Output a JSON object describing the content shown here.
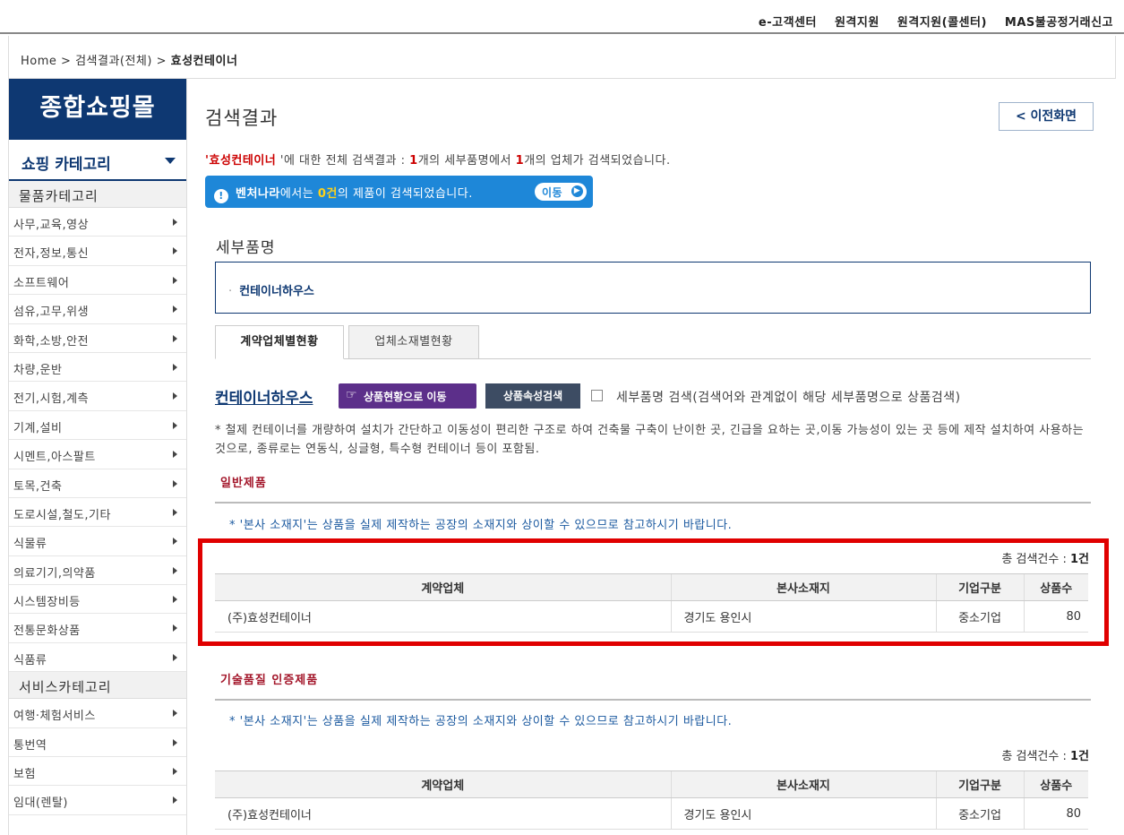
{
  "util_links": [
    "e-고객센터",
    "원격지원",
    "원격지원(콜센터)",
    "MAS불공정거래신고"
  ],
  "breadcrumb": {
    "home": "Home",
    "sep1": " > ",
    "mid": "검색결과(전체)",
    "sep2": " > ",
    "current": "효성컨테이너"
  },
  "sidebar": {
    "brand": "종합쇼핑몰",
    "category_head": "쇼핑 카테고리",
    "goods_group": "물품카테고리",
    "goods_items": [
      "사무,교육,영상",
      "전자,정보,통신",
      "소프트웨어",
      "섬유,고무,위생",
      "화학,소방,안전",
      "차량,운반",
      "전기,시험,계측",
      "기계,설비",
      "시멘트,아스팔트",
      "토목,건축",
      "도로시설,철도,기타",
      "식물류",
      "의료기기,의약품",
      "시스템장비등",
      "전통문화상품",
      "식품류"
    ],
    "service_group": "서비스카테고리",
    "service_items": [
      "여행·체험서비스",
      "통번역",
      "보험",
      "임대(렌탈)"
    ]
  },
  "main": {
    "title": "검색결과",
    "back_button": "< 이전화면",
    "summary": {
      "q1": "'",
      "keyword": "효성컨테이너",
      "q2": " '에 대한 전체 검색결과 : ",
      "n1": "1",
      "t1": "개의 세부품명에서 ",
      "n2": "1",
      "t2": "개의 업체가 검색되었습니다."
    },
    "venture": {
      "icon": "!",
      "name": "벤처나라",
      "t1": "에서는 ",
      "count": "0건",
      "t2": "의 제품이 검색되었습니다.",
      "move": "이동"
    },
    "detail_title": "세부품명",
    "detail_item": "컨테이너하우스",
    "tabs": [
      "계약업체별현황",
      "업체소재별현황"
    ],
    "product_name": "컨테이너하우스",
    "btn_status": "상품현황으로 이동",
    "btn_attr": "상품속성검색",
    "checkbox_label": "세부품명 검색(검색어와 관계없이 해당 세부품명으로 상품검색)",
    "description": "* 철제 컨테이너를 개량하여 설치가 간단하고 이동성이 편리한 구조로 하여 건축물 구축이 난이한 곳, 긴급을 요하는 곳,이동 가능성이 있는 곳 등에 제작 설치하여 사용하는 것으로, 종류로는 연동식, 싱글형, 특수형 컨테이너 등이 포함됨.",
    "sections": [
      {
        "title": "일반제품",
        "note": "* '본사 소재지'는 상품을 실제 제작하는 공장의 소재지와 상이할 수 있으므로 참고하시기 바랍니다.",
        "total_label": "총 검색건수 : ",
        "total_value": "1건",
        "headers": [
          "계약업체",
          "본사소재지",
          "기업구분",
          "상품수"
        ],
        "rows": [
          [
            "(주)효성컨테이너",
            "경기도 용인시",
            "중소기업",
            "80"
          ]
        ]
      },
      {
        "title": "기술품질 인증제품",
        "note": "* '본사 소재지'는 상품을 실제 제작하는 공장의 소재지와 상이할 수 있으므로 참고하시기 바랍니다.",
        "total_label": "총 검색건수 : ",
        "total_value": "1건",
        "headers": [
          "계약업체",
          "본사소재지",
          "기업구분",
          "상품수"
        ],
        "rows": [
          [
            "(주)효성컨테이너",
            "경기도 용인시",
            "중소기업",
            "80"
          ]
        ]
      }
    ]
  }
}
